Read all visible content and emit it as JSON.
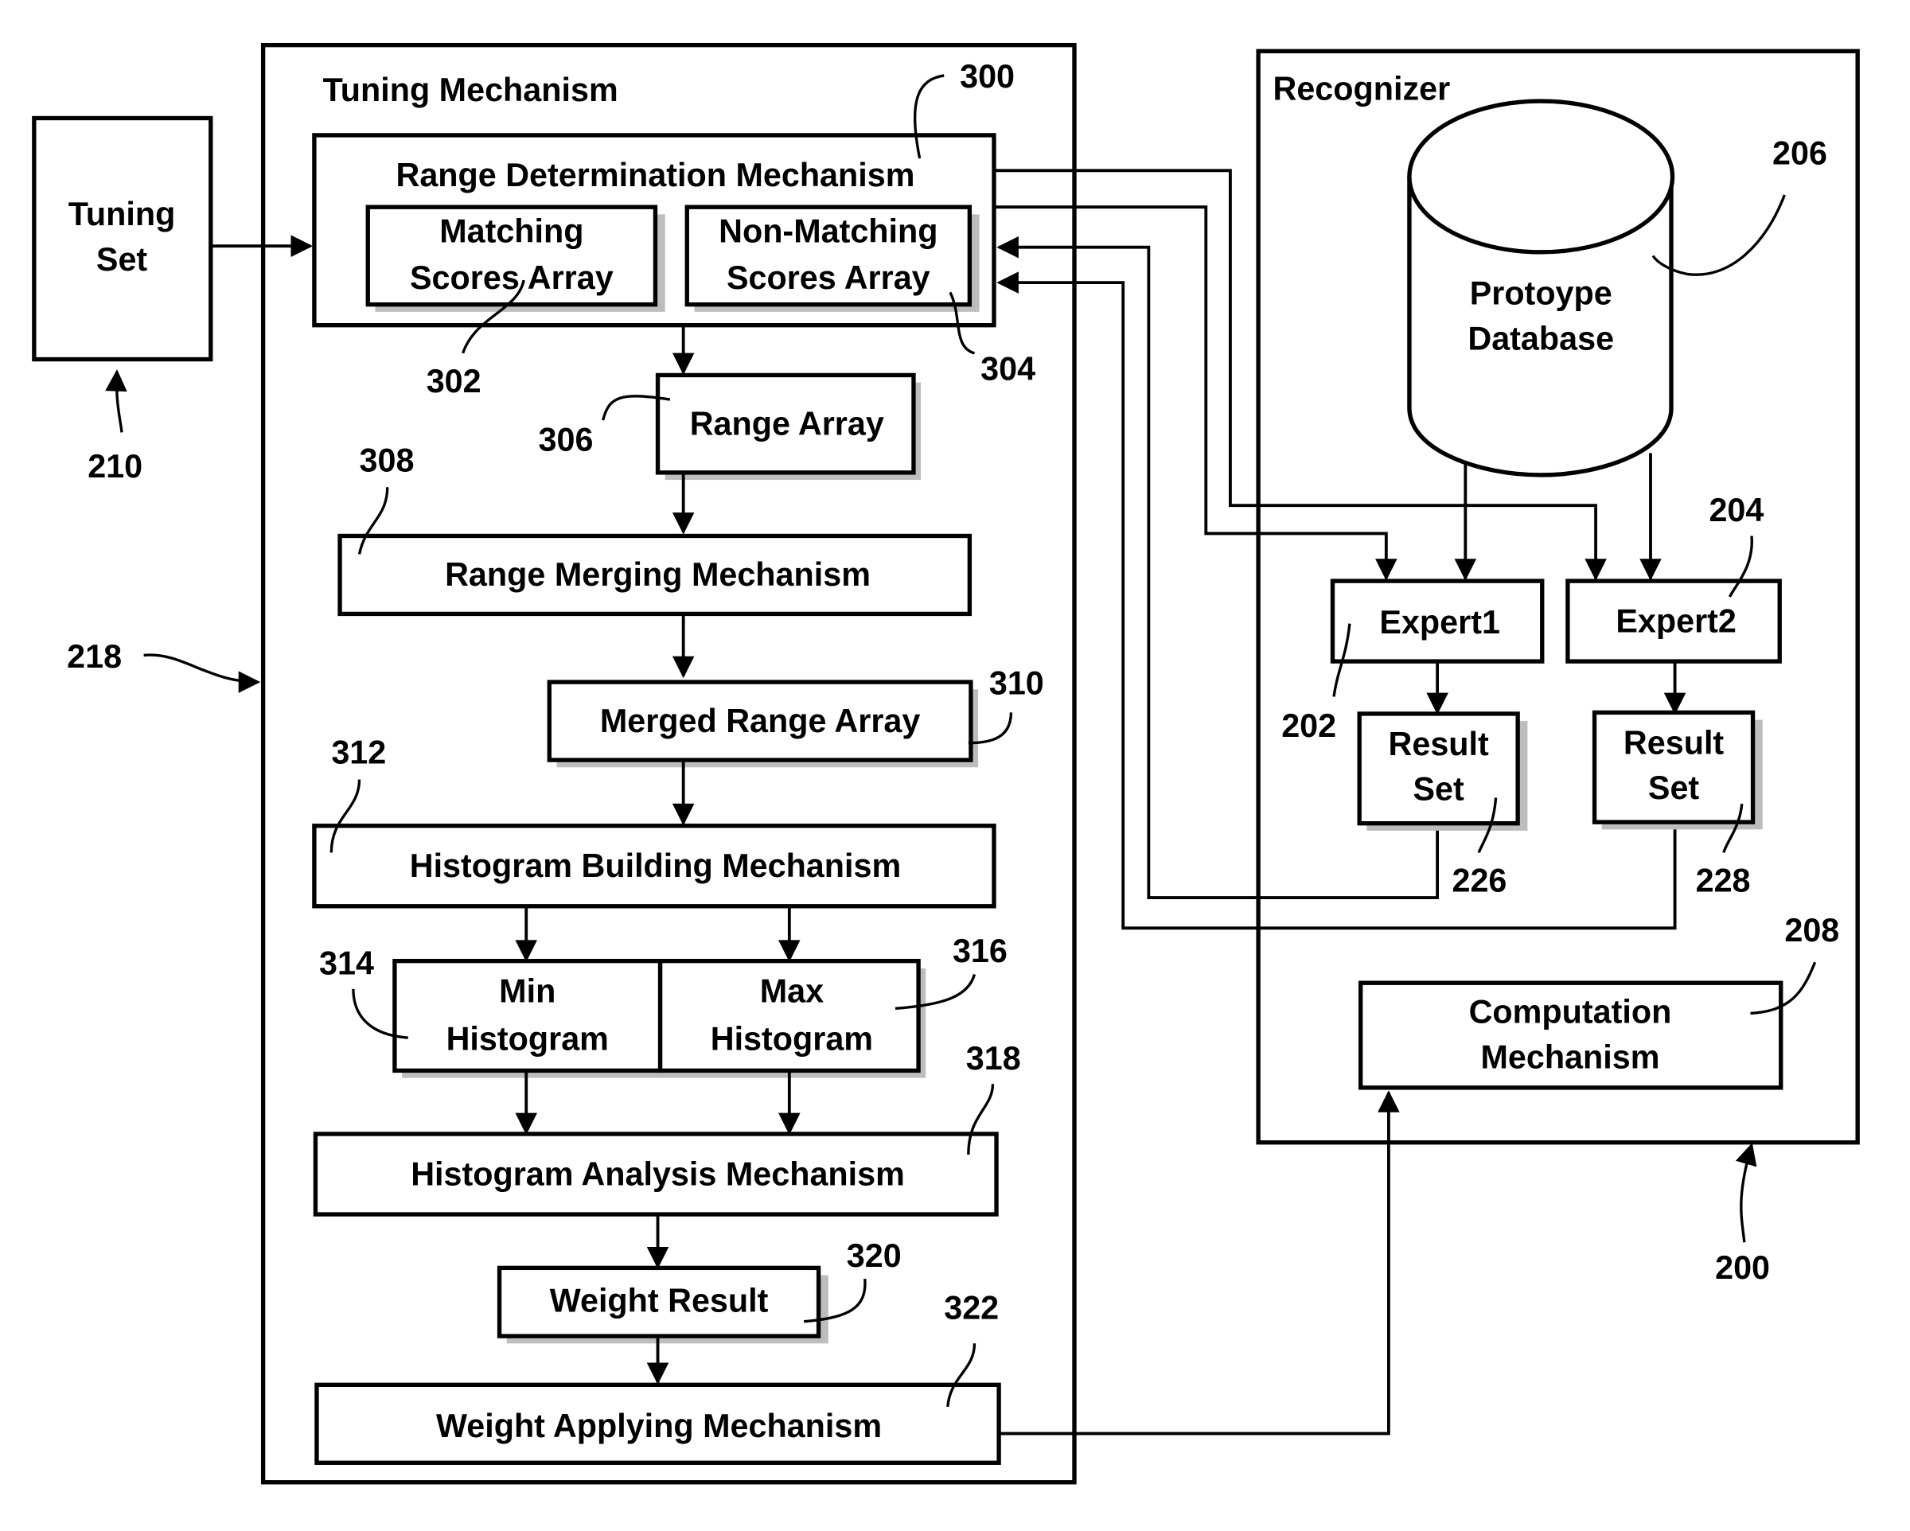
{
  "tuning_set": {
    "line1": "Tuning",
    "line2": "Set",
    "ref": "210"
  },
  "tuning_mechanism": {
    "title": "Tuning Mechanism",
    "ref": "218",
    "range_determination": {
      "label": "Range Determination Mechanism",
      "ref": "300",
      "matching": {
        "line1": "Matching",
        "line2": "Scores Array",
        "ref": "302"
      },
      "non_matching": {
        "line1": "Non-Matching",
        "line2": "Scores Array",
        "ref": "304"
      }
    },
    "range_array": {
      "label": "Range Array",
      "ref": "306"
    },
    "range_merging": {
      "label": "Range Merging Mechanism",
      "ref": "308"
    },
    "merged_range_array": {
      "label": "Merged Range Array",
      "ref": "310"
    },
    "histogram_building": {
      "label": "Histogram Building Mechanism",
      "ref": "312"
    },
    "min_histogram": {
      "line1": "Min",
      "line2": "Histogram",
      "ref": "314"
    },
    "max_histogram": {
      "line1": "Max",
      "line2": "Histogram",
      "ref": "316"
    },
    "histogram_analysis": {
      "label": "Histogram Analysis Mechanism",
      "ref": "318"
    },
    "weight_result": {
      "label": "Weight Result",
      "ref": "320"
    },
    "weight_applying": {
      "label": "Weight Applying Mechanism",
      "ref": "322"
    }
  },
  "recognizer": {
    "title": "Recognizer",
    "ref": "200",
    "database": {
      "line1": "Protoype",
      "line2": "Database",
      "ref": "206"
    },
    "expert1": {
      "label": "Expert1",
      "ref": "202"
    },
    "expert2": {
      "label": "Expert2",
      "ref": "204"
    },
    "result_set1": {
      "line1": "Result",
      "line2": "Set",
      "ref": "226"
    },
    "result_set2": {
      "line1": "Result",
      "line2": "Set",
      "ref": "228"
    },
    "computation": {
      "line1": "Computation",
      "line2": "Mechanism",
      "ref": "208"
    }
  }
}
